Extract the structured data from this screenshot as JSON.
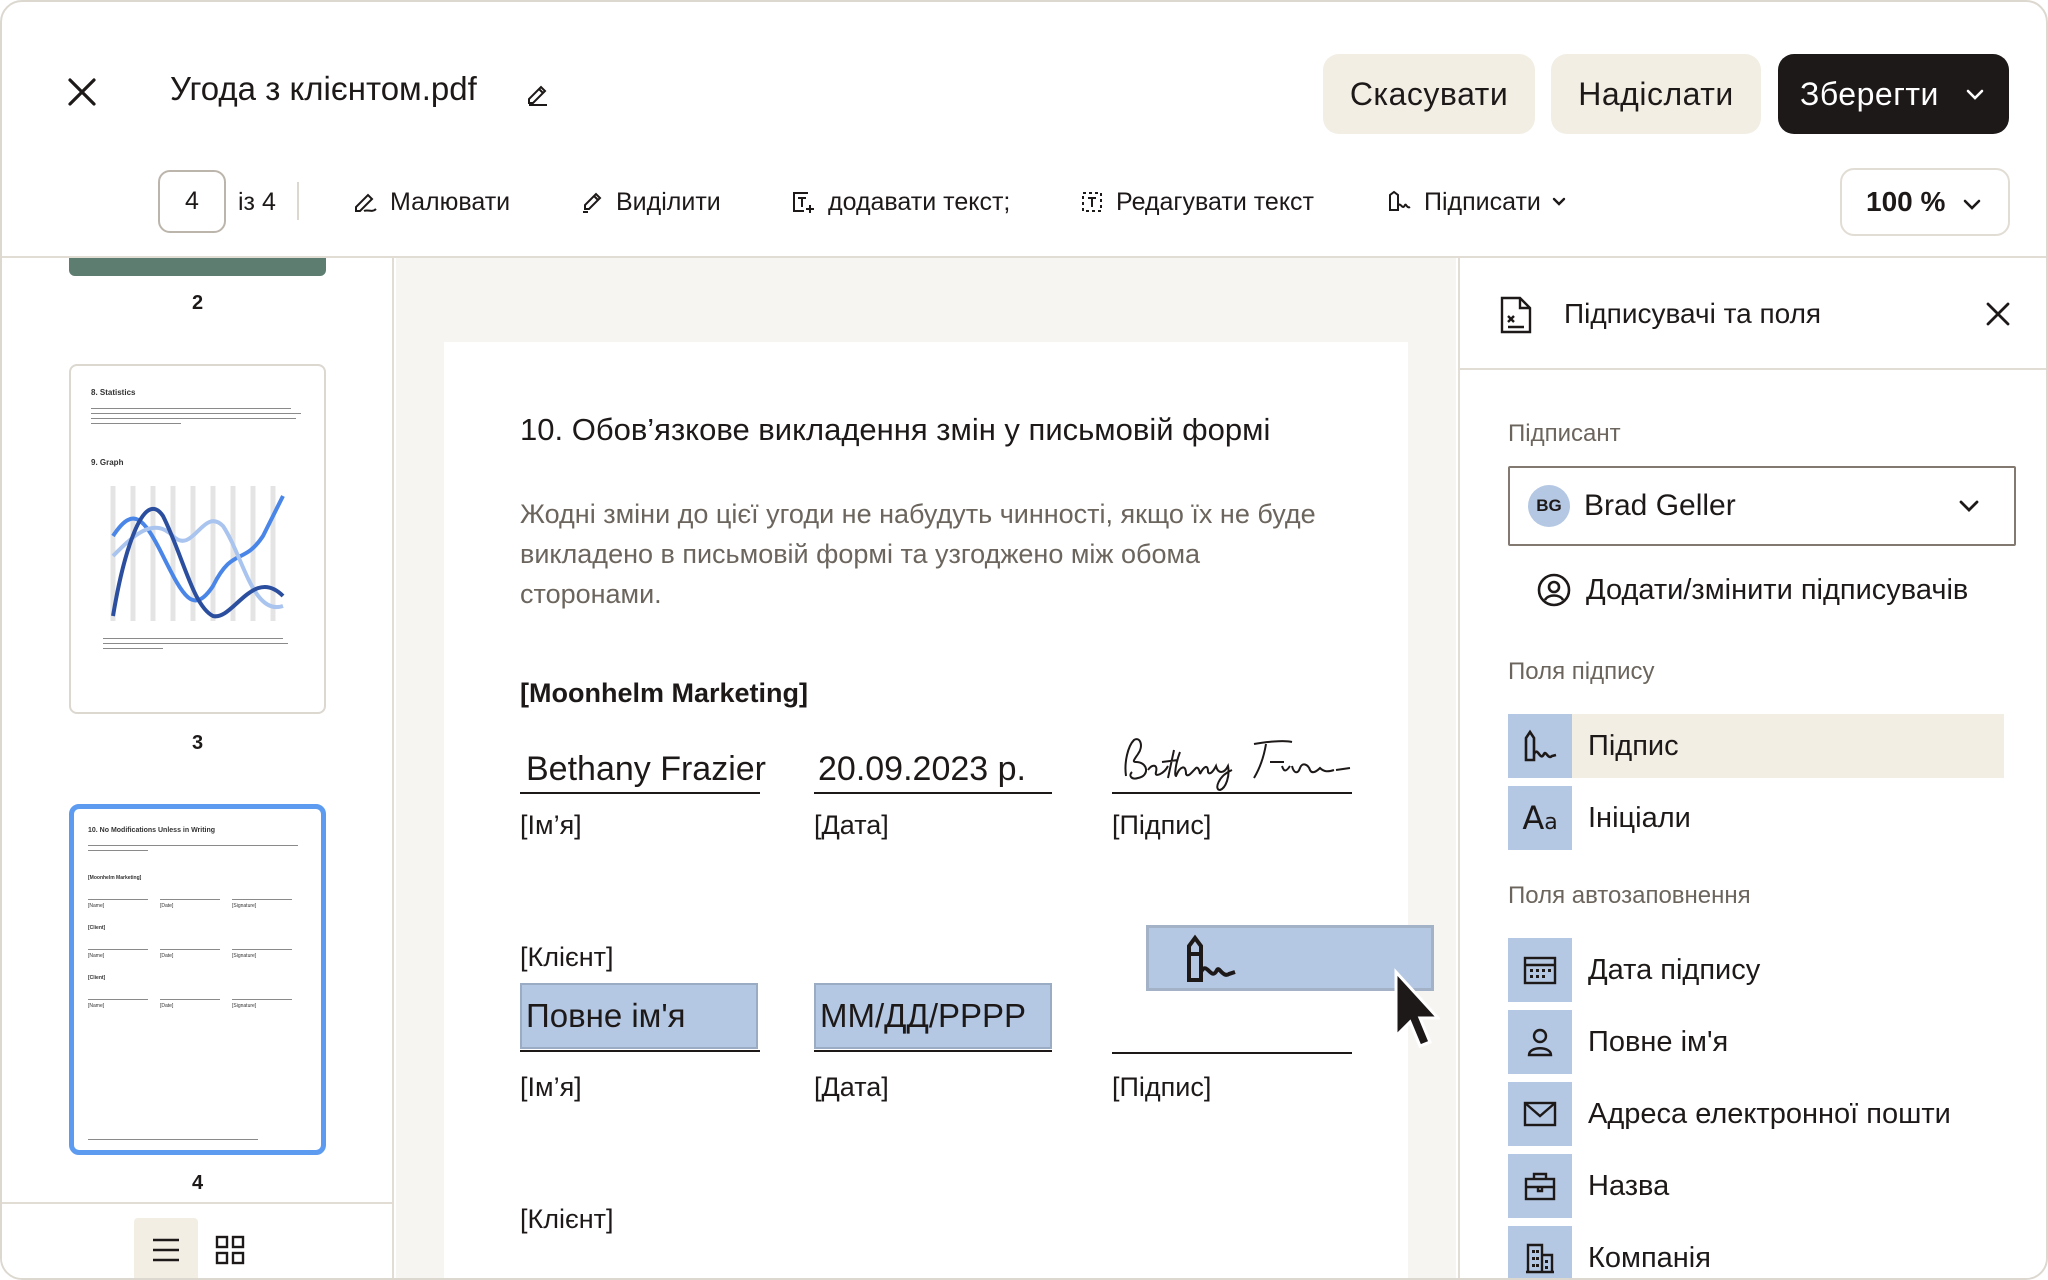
{
  "header": {
    "title_main": "Угода з клієнтом",
    "title_ext": ".pdf",
    "cancel_label": "Скасувати",
    "send_label": "Надіслати",
    "save_label": "Зберегти"
  },
  "toolbar": {
    "page_current": "4",
    "page_of": "із 4",
    "draw_label": "Малювати",
    "highlight_label": "Виділити",
    "add_text_label": "додавати текст;",
    "edit_text_label": "Редагувати текст",
    "sign_label": "Підписати",
    "zoom_label": "100 %"
  },
  "thumbnails": {
    "pages": [
      {
        "number": "2"
      },
      {
        "number": "3",
        "h1": "8. Statistics",
        "h2": "9. Graph"
      },
      {
        "number": "4",
        "h1": "10. No Modifications Unless in Writing",
        "s1": "[Moonhelm Marketing]",
        "s2": "[Client]",
        "s3": "[Client]",
        "name": "[Name]",
        "date": "[Date]",
        "sig": "[Signature]"
      }
    ]
  },
  "document": {
    "heading": "10. Обов’язкове викладення змін у письмовій формі",
    "body": "Жодні зміни до цієї угоди не набудуть чинності, якщо їх не буде викладено в письмовій формі та узгоджено між обома сторонами.",
    "party1": "[Moonhelm Marketing]",
    "name_value": "Bethany Frazier",
    "date_value": "20.09.2023 р.",
    "name_label": "[Ім’я]",
    "date_label": "[Дата]",
    "sig_label": "[Підпис]",
    "client_label": "[Клієнт]",
    "fullname_placeholder": "Повне ім'я",
    "date_placeholder": "ММ/ДД/РРРР"
  },
  "right_panel": {
    "title": "Підписувачі та поля",
    "signer_section": "Підписант",
    "signer_initials": "BG",
    "signer_name": "Brad Geller",
    "add_signers": "Додати/змінити підписувачів",
    "signature_fields_section": "Поля підпису",
    "signature_fields": [
      {
        "label": "Підпис",
        "icon": "signature-icon"
      },
      {
        "label": "Ініціали",
        "icon": "initials-icon"
      }
    ],
    "autofill_section": "Поля автозаповнення",
    "autofill_fields": [
      {
        "label": "Дата підпису",
        "icon": "calendar-icon"
      },
      {
        "label": "Повне ім'я",
        "icon": "person-icon"
      },
      {
        "label": "Адреса електронної пошти",
        "icon": "mail-icon"
      },
      {
        "label": "Назва",
        "icon": "briefcase-icon"
      },
      {
        "label": "Компанія",
        "icon": "building-icon"
      }
    ]
  },
  "colors": {
    "accent_blue": "#b4c7e3",
    "thumb_active_border": "#5d9bf0",
    "dark_button": "#1e1919",
    "beige_button": "#f2eee4"
  }
}
